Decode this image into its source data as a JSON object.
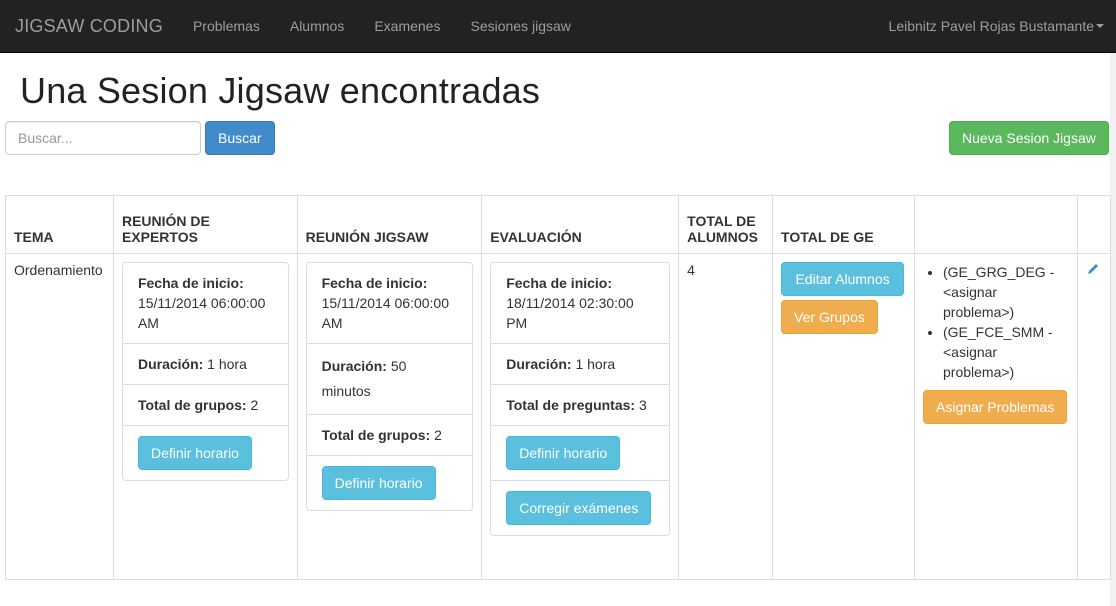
{
  "navbar": {
    "brand": "JIGSAW CODING",
    "links": [
      "Problemas",
      "Alumnos",
      "Examenes",
      "Sesiones jigsaw"
    ],
    "user": "Leibnitz Pavel Rojas Bustamante"
  },
  "page": {
    "title": "Una Sesion Jigsaw encontradas",
    "search_placeholder": "Buscar...",
    "search_button": "Buscar",
    "new_button": "Nueva Sesion Jigsaw"
  },
  "table": {
    "headers": {
      "tema": "TEMA",
      "expertos": "REUNIÓN DE EXPERTOS",
      "jigsaw": "REUNIÓN JIGSAW",
      "evaluacion": "EVALUACIÓN",
      "total_alumnos_1": "TOTAL DE",
      "total_alumnos_2": "ALUMNOS",
      "total_ge": "TOTAL DE GE"
    },
    "row": {
      "tema": "Ordenamiento",
      "expertos": {
        "fecha_label": "Fecha de inicio:",
        "fecha_value": "15/11/2014 06:00:00 AM",
        "duracion_label": "Duración:",
        "duracion_value": " 1 hora",
        "grupos_label": "Total de grupos:",
        "grupos_value": " 2",
        "button": "Definir horario"
      },
      "jigsaw": {
        "fecha_label": "Fecha de inicio:",
        "fecha_value": "15/11/2014 06:00:00 AM",
        "duracion_label": "Duración:",
        "duracion_value": " 50 minutos",
        "grupos_label": "Total de grupos:",
        "grupos_value": " 2",
        "button": "Definir horario"
      },
      "evaluacion": {
        "fecha_label": "Fecha de inicio:",
        "fecha_value": "18/11/2014 02:30:00 PM",
        "duracion_label": "Duración:",
        "duracion_value": " 1 hora",
        "preguntas_label": "Total de preguntas:",
        "preguntas_value": " 3",
        "button_horario": "Definir horario",
        "button_corregir": "Corregir exámenes"
      },
      "total_alumnos": "4",
      "buttons": {
        "editar": "Editar Alumnos",
        "ver": "Ver Grupos"
      },
      "ge_items": [
        "(GE_GRG_DEG - <asignar problema>)",
        "(GE_FCE_SMM - <asignar problema>)"
      ],
      "asignar_button": "Asignar Problemas"
    }
  },
  "colors": {
    "navbar": "#222222",
    "primary": "#428bca",
    "success": "#5cb85c",
    "info": "#5bc0de",
    "warning": "#f0ad4e"
  }
}
